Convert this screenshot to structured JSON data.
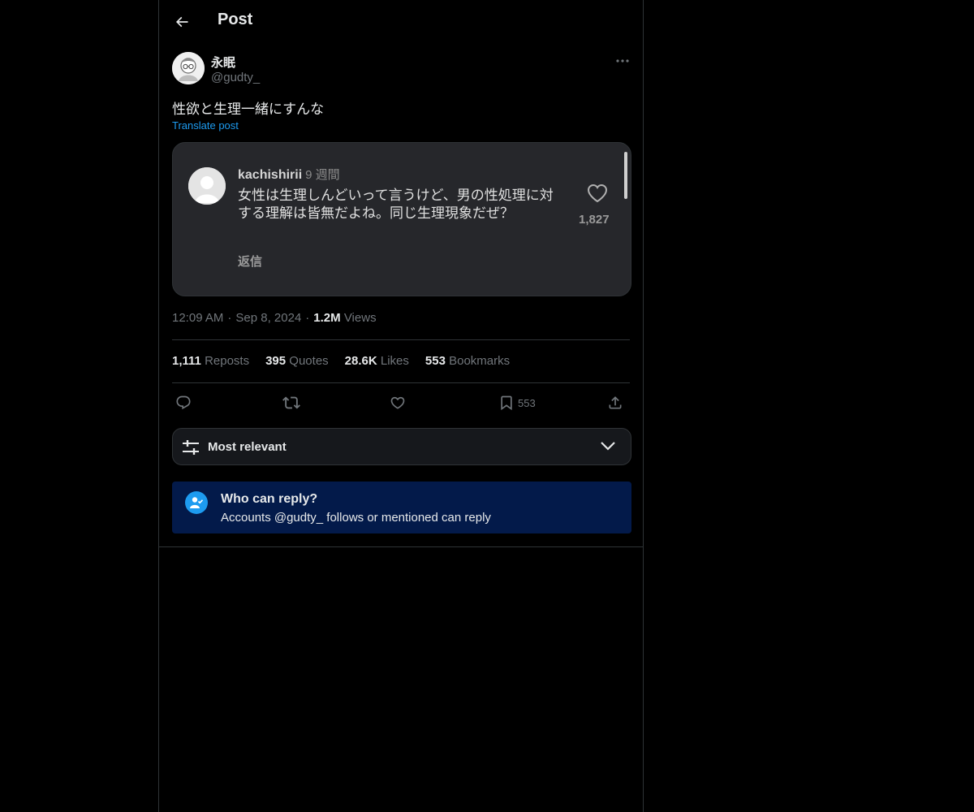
{
  "header": {
    "title": "Post"
  },
  "author": {
    "name": "永眠",
    "handle": "@gudty_"
  },
  "post": {
    "text": "性欲と生理一緒にすんな",
    "translate_label": "Translate post"
  },
  "media": {
    "username": "kachishirii",
    "time": "9 週間",
    "comment": "女性は生理しんどいって言うけど、男の性処理に対する理解は皆無だよね。同じ生理現象だぜ？",
    "reply_label": "返信",
    "likes": "1,827"
  },
  "meta": {
    "time": "12:09 AM",
    "date": "Sep 8, 2024",
    "views_count": "1.2M",
    "views_label": "Views"
  },
  "stats": {
    "reposts_count": "1,111",
    "reposts_label": "Reposts",
    "quotes_count": "395",
    "quotes_label": "Quotes",
    "likes_count": "28.6K",
    "likes_label": "Likes",
    "bookmarks_count": "553",
    "bookmarks_label": "Bookmarks"
  },
  "actions": {
    "bookmark_count": "553",
    "icons": [
      "reply-icon",
      "repost-icon",
      "like-icon",
      "bookmark-icon",
      "share-icon"
    ]
  },
  "sort": {
    "label": "Most relevant"
  },
  "reply_restriction": {
    "title": "Who can reply?",
    "description": "Accounts @gudty_ follows or mentioned can reply"
  },
  "colors": {
    "background": "#000000",
    "text": "#e7e9ea",
    "muted": "#71767b",
    "accent": "#1d9bf0",
    "reply_box": "#031a4a"
  }
}
